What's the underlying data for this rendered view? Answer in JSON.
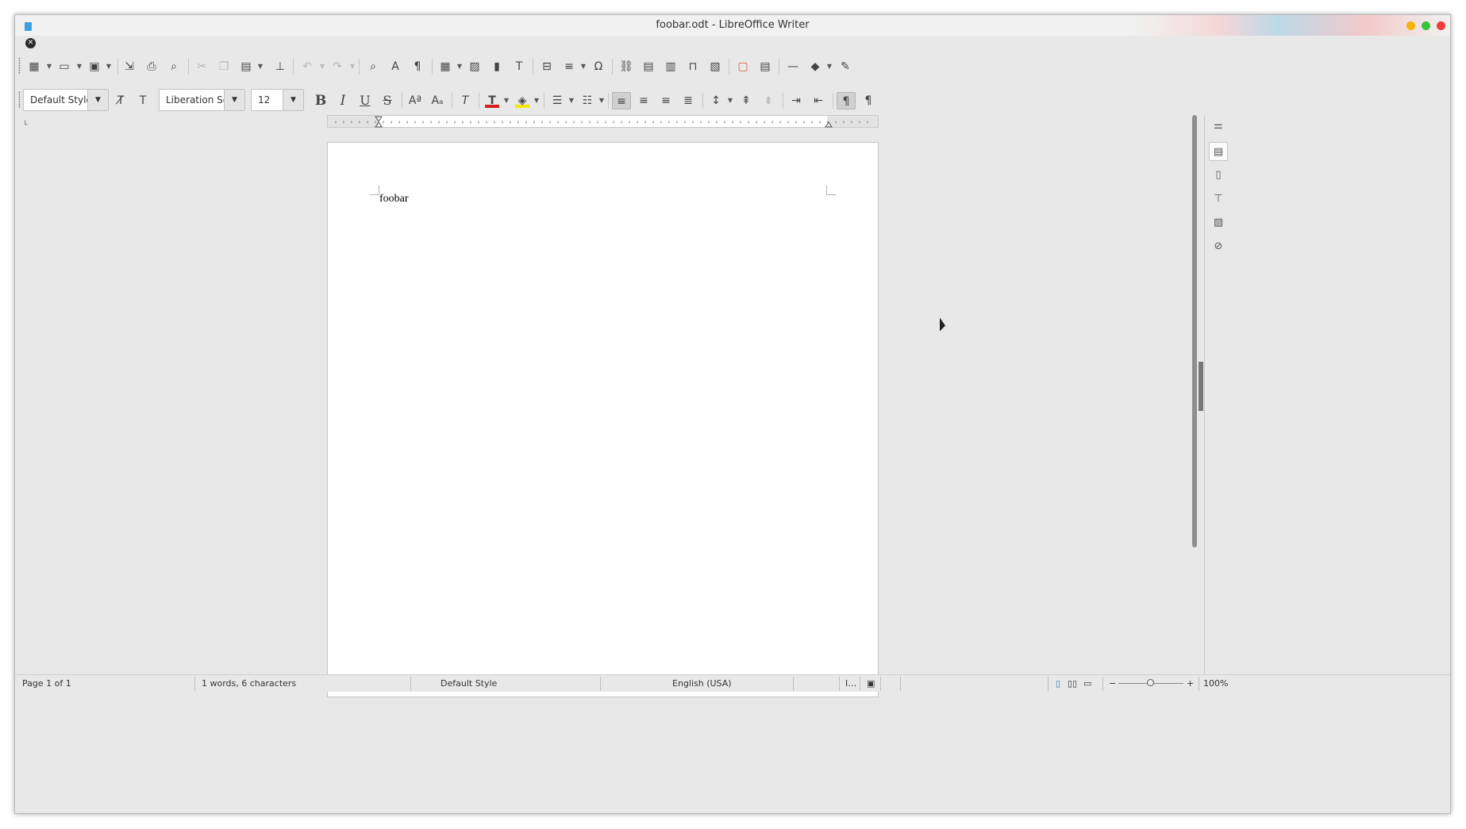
{
  "window": {
    "title": "foobar.odt - LibreOffice Writer"
  },
  "toolbar_standard": [
    {
      "name": "new-document",
      "icon": "▦",
      "caret": true,
      "enabled": true
    },
    {
      "name": "open",
      "icon": "▭",
      "caret": true,
      "enabled": true
    },
    {
      "name": "save",
      "icon": "▣",
      "caret": true,
      "enabled": true
    },
    {
      "name": "export-pdf",
      "icon": "⇲",
      "enabled": true
    },
    {
      "name": "print",
      "icon": "⎙",
      "enabled": true
    },
    {
      "name": "print-preview",
      "icon": "⌕",
      "enabled": true
    },
    {
      "name": "cut",
      "icon": "✂",
      "enabled": false
    },
    {
      "name": "copy",
      "icon": "❐",
      "enabled": false
    },
    {
      "name": "paste",
      "icon": "📋",
      "caret": true,
      "enabled": true
    },
    {
      "name": "clone-formatting",
      "icon": "⊥",
      "enabled": true
    },
    {
      "name": "undo",
      "icon": "↶",
      "caret": true,
      "enabled": false
    },
    {
      "name": "redo",
      "icon": "↷",
      "caret": true,
      "enabled": false
    },
    {
      "name": "find-replace",
      "icon": "⌕",
      "enabled": true
    },
    {
      "name": "spelling",
      "icon": "A",
      "enabled": true
    },
    {
      "name": "formatting-marks",
      "icon": "¶",
      "enabled": true
    },
    {
      "name": "insert-table",
      "icon": "▦",
      "caret": true,
      "enabled": true
    },
    {
      "name": "insert-image",
      "icon": "▨",
      "enabled": true
    },
    {
      "name": "insert-chart",
      "icon": "▮",
      "enabled": true
    },
    {
      "name": "insert-text-box",
      "icon": "T",
      "enabled": true
    },
    {
      "name": "insert-page-break",
      "icon": "⊟",
      "enabled": true
    },
    {
      "name": "insert-field",
      "icon": "≡",
      "caret": true,
      "enabled": true
    },
    {
      "name": "special-character",
      "icon": "Ω",
      "enabled": true
    },
    {
      "name": "hyperlink",
      "icon": "⛓",
      "enabled": true
    },
    {
      "name": "footnote",
      "icon": "▤",
      "enabled": true
    },
    {
      "name": "endnote",
      "icon": "▥",
      "enabled": true
    },
    {
      "name": "bookmark",
      "icon": "⊓",
      "enabled": true
    },
    {
      "name": "cross-reference",
      "icon": "▧",
      "enabled": true
    },
    {
      "name": "comment",
      "icon": "▢",
      "enabled": true
    },
    {
      "name": "track-changes",
      "icon": "▤",
      "enabled": true
    },
    {
      "name": "insert-line",
      "icon": "—",
      "enabled": true
    },
    {
      "name": "basic-shapes",
      "icon": "◆",
      "caret": true,
      "enabled": true
    },
    {
      "name": "draw-functions",
      "icon": "✎",
      "enabled": true
    }
  ],
  "toolbar_formatting": {
    "paragraph_style": "Default Style",
    "font_name": "Liberation Ser",
    "font_size": "12",
    "colors": {
      "font_color": "#d42020",
      "highlight_color": "#f5e600"
    }
  },
  "document": {
    "text": "foobar"
  },
  "statusbar": {
    "page": "Page 1 of 1",
    "word_count": "1 words, 6 characters",
    "page_style": "Default Style",
    "language": "English (USA)",
    "zoom": "100%",
    "zoom_minus": "−",
    "zoom_plus": "+"
  }
}
